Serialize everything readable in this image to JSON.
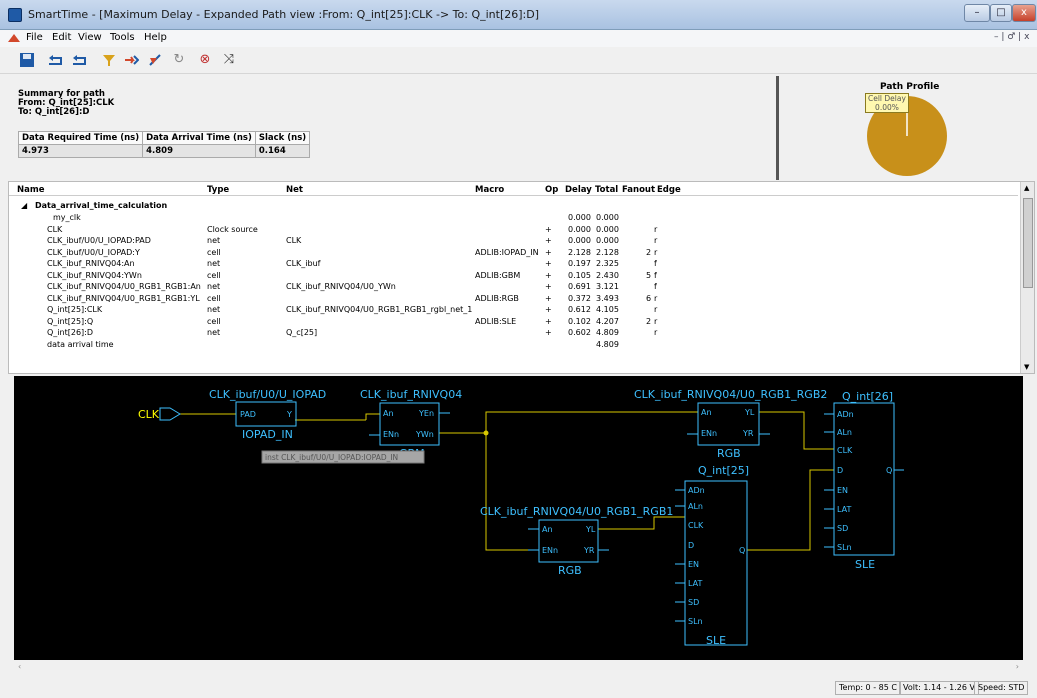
{
  "window": {
    "title": "SmartTime - [Maximum Delay - Expanded Path view :From: Q_int[25]:CLK -> To: Q_int[26]:D]",
    "minimize": "–",
    "maximize": "□",
    "close": "x"
  },
  "menu": {
    "items": [
      "File",
      "Edit",
      "View",
      "Tools",
      "Help"
    ],
    "mdi": "– | ♂ | x"
  },
  "toolbar": {
    "icons": [
      "save-icon",
      "open-left-icon",
      "open-right-icon",
      "filter-icon",
      "expand-icon",
      "collapse-icon",
      "refresh-icon",
      "probe-icon",
      "crossprobe-icon"
    ]
  },
  "summary": {
    "heading": "Summary for path",
    "from": "From: Q_int[25]:CLK",
    "to": "To: Q_int[26]:D",
    "columns": [
      "Data Required Time (ns)",
      "Data Arrival Time (ns)",
      "Slack (ns)"
    ],
    "values": [
      "4.973",
      "4.809",
      "0.164"
    ]
  },
  "path_profile": {
    "title": "Path Profile",
    "legend": "Cell Delay",
    "legend_value": "0.00%",
    "color": "#c8901a"
  },
  "grid": {
    "columns": [
      "Name",
      "Type",
      "Net",
      "Macro",
      "Op",
      "Delay",
      "Total",
      "Fanout",
      "Edge"
    ],
    "group": "Data_arrival_time_calculation",
    "rows": [
      {
        "name": "my_clk",
        "type": "",
        "net": "",
        "macro": "",
        "op": "",
        "delay": "0.000",
        "total": "0.000",
        "fanout": "",
        "edge": ""
      },
      {
        "name": "CLK",
        "type": "Clock source",
        "net": "",
        "macro": "",
        "op": "+",
        "delay": "0.000",
        "total": "0.000",
        "fanout": "",
        "edge": "r"
      },
      {
        "name": "CLK_ibuf/U0/U_IOPAD:PAD",
        "type": "net",
        "net": "CLK",
        "macro": "",
        "op": "+",
        "delay": "0.000",
        "total": "0.000",
        "fanout": "",
        "edge": "r"
      },
      {
        "name": "CLK_ibuf/U0/U_IOPAD:Y",
        "type": "cell",
        "net": "",
        "macro": "ADLIB:IOPAD_IN",
        "op": "+",
        "delay": "2.128",
        "total": "2.128",
        "fanout": "2",
        "edge": "r"
      },
      {
        "name": "CLK_ibuf_RNIVQ04:An",
        "type": "net",
        "net": "CLK_ibuf",
        "macro": "",
        "op": "+",
        "delay": "0.197",
        "total": "2.325",
        "fanout": "",
        "edge": "f"
      },
      {
        "name": "CLK_ibuf_RNIVQ04:YWn",
        "type": "cell",
        "net": "",
        "macro": "ADLIB:GBM",
        "op": "+",
        "delay": "0.105",
        "total": "2.430",
        "fanout": "5",
        "edge": "f"
      },
      {
        "name": "CLK_ibuf_RNIVQ04/U0_RGB1_RGB1:An",
        "type": "net",
        "net": "CLK_ibuf_RNIVQ04/U0_YWn",
        "macro": "",
        "op": "+",
        "delay": "0.691",
        "total": "3.121",
        "fanout": "",
        "edge": "f"
      },
      {
        "name": "CLK_ibuf_RNIVQ04/U0_RGB1_RGB1:YL",
        "type": "cell",
        "net": "",
        "macro": "ADLIB:RGB",
        "op": "+",
        "delay": "0.372",
        "total": "3.493",
        "fanout": "6",
        "edge": "r"
      },
      {
        "name": "Q_int[25]:CLK",
        "type": "net",
        "net": "CLK_ibuf_RNIVQ04/U0_RGB1_RGB1_rgbl_net_1",
        "macro": "",
        "op": "+",
        "delay": "0.612",
        "total": "4.105",
        "fanout": "",
        "edge": "r"
      },
      {
        "name": "Q_int[25]:Q",
        "type": "cell",
        "net": "",
        "macro": "ADLIB:SLE",
        "op": "+",
        "delay": "0.102",
        "total": "4.207",
        "fanout": "2",
        "edge": "r"
      },
      {
        "name": "Q_int[26]:D",
        "type": "net",
        "net": "Q_c[25]",
        "macro": "",
        "op": "+",
        "delay": "0.602",
        "total": "4.809",
        "fanout": "",
        "edge": "r"
      },
      {
        "name": "data arrival time",
        "type": "",
        "net": "",
        "macro": "",
        "op": "",
        "delay": "",
        "total": "4.809",
        "fanout": "",
        "edge": ""
      }
    ]
  },
  "schematic": {
    "port": "CLK",
    "iopad": {
      "title": "CLK_ibuf/U0/U_IOPAD",
      "pin_in": "PAD",
      "pin_out": "Y",
      "type": "IOPAD_IN"
    },
    "gbm": {
      "title": "CLK_ibuf_RNIVQ04",
      "pins_in": [
        "An",
        "ENn"
      ],
      "pins_out": [
        "YEn",
        "YWn"
      ],
      "type": "GBM"
    },
    "tooltip": "inst CLK_ibuf/U0/U_IOPAD:IOPAD_IN",
    "rgb2": {
      "title": "CLK_ibuf_RNIVQ04/U0_RGB1_RGB2",
      "pins_in": [
        "An",
        "ENn"
      ],
      "pins_out": [
        "YL",
        "YR"
      ],
      "type": "RGB"
    },
    "rgb1": {
      "title": "CLK_ibuf_RNIVQ04/U0_RGB1_RGB1",
      "pins_in": [
        "An",
        "ENn"
      ],
      "pins_out": [
        "YL",
        "YR"
      ],
      "type": "RGB"
    },
    "q26": {
      "title": "Q_int[26]",
      "pins": [
        "ADn",
        "ALn",
        "CLK",
        "D",
        "EN",
        "LAT",
        "SD",
        "SLn"
      ],
      "out": "Q",
      "type": "SLE"
    },
    "q25": {
      "title": "Q_int[25]",
      "pins": [
        "ADn",
        "ALn",
        "CLK",
        "D",
        "EN",
        "LAT",
        "SD",
        "SLn"
      ],
      "out": "Q",
      "type": "SLE"
    }
  },
  "status": {
    "temp": "Temp: 0 - 85 C",
    "volt": "Volt: 1.14 - 1.26 V",
    "speed": "Speed: STD"
  }
}
